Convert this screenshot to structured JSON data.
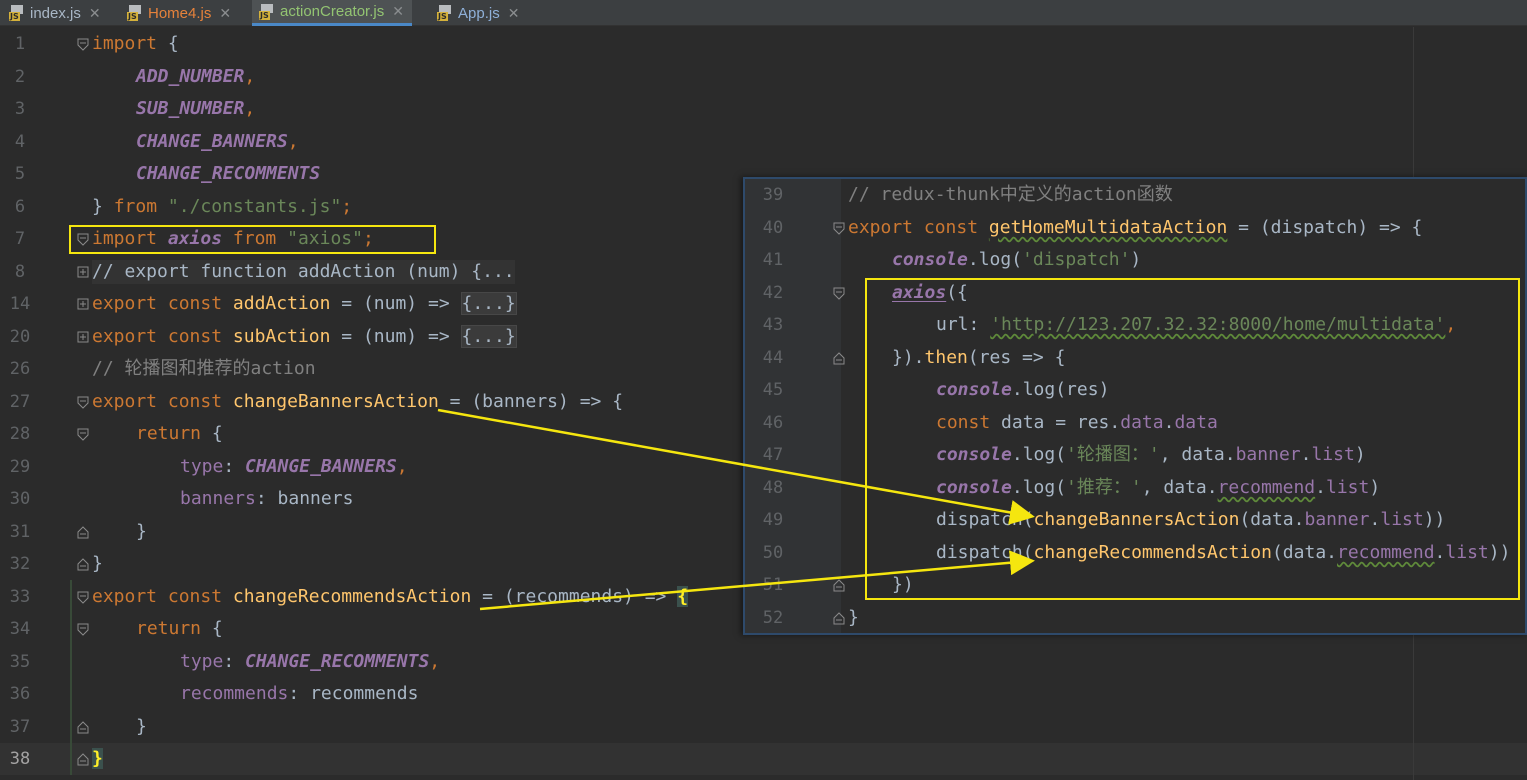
{
  "tabs": [
    {
      "name": "index.js",
      "color": "#a9b7c6",
      "active": false
    },
    {
      "name": "Home4.js",
      "color": "#e6823b",
      "active": false
    },
    {
      "name": "actionCreator.js",
      "color": "#93c472",
      "active": true
    },
    {
      "name": "App.js",
      "color": "#8fb0d8",
      "active": false
    }
  ],
  "tab_close_glyph": "✕",
  "line_numbers": [
    "1",
    "2",
    "3",
    "4",
    "5",
    "6",
    "7",
    "8",
    "14",
    "20",
    "26",
    "27",
    "28",
    "29",
    "30",
    "31",
    "32",
    "33",
    "34",
    "35",
    "36",
    "37",
    "38"
  ],
  "code": {
    "import_kw": "import",
    "open_brace": " {",
    "c1": "ADD_NUMBER",
    "c2": "SUB_NUMBER",
    "c3": "CHANGE_BANNERS",
    "c4": "CHANGE_RECOMMENTS",
    "comma": ",",
    "close_from": "} ",
    "from_kw": "from",
    "const_path": "\"./constants.js\"",
    "semi": ";",
    "axios_id": "axios",
    "axios_str": "\"axios\"",
    "comment_export": "// export function addAction (num) {...",
    "export_kw": "export",
    "const_kw": "const",
    "add_action": "addAction",
    "sub_action": "subAction",
    "num_arrow": " = (num) => ",
    "collapsed_body": "{...}",
    "comment_banner": "// 轮播图和推荐的action",
    "change_banners": "changeBannersAction",
    "banners_sig": " = (banners) => {",
    "return_kw": "return",
    "type_key": "type",
    "colon_sp": ": ",
    "banners_key": "banners",
    "banners_val": "banners",
    "close_brace": "}",
    "change_recs": "changeRecommendsAction",
    "recs_sig": " = (recommends) => ",
    "recommends_key": "recommends",
    "recommends_val": "recommends",
    "open_brace_only": "{"
  },
  "popup": {
    "line_numbers": [
      "39",
      "40",
      "41",
      "42",
      "43",
      "44",
      "45",
      "46",
      "47",
      "48",
      "49",
      "50",
      "51",
      "52"
    ],
    "comment": "// redux-thunk中定义的action函数",
    "fn_name": "getHomeMultidataAction",
    "fn_sig": " = (dispatch) => {",
    "console": "console",
    "log": ".log(",
    "str_dispatch": "'dispatch'",
    "close_paren": ")",
    "axios_call": "axios",
    "axios_open": "({",
    "url_key": "url",
    "url_val": "'http://123.207.32.32:8000/home/multidata'",
    "then_line_a": "}).",
    "then": "then",
    "then_line_b": "(res => {",
    "res": "res",
    "const_data": "const",
    "data_assign": " data = res.",
    "data_prop": "data",
    "dot": ".",
    "str_banner": "'轮播图：'",
    "str_recommend": "'推荐：'",
    "args_data": ", data.",
    "banner_prop": "banner",
    "list_prop": "list",
    "recommend_prop": "recommend",
    "dispatch_fn": "dispatch(",
    "change_banners": "changeBannersAction",
    "change_recs": "changeRecommendsAction",
    "data_arg": "(data.",
    "close_2": "))",
    "close_then": "})",
    "close_fn": "}"
  }
}
